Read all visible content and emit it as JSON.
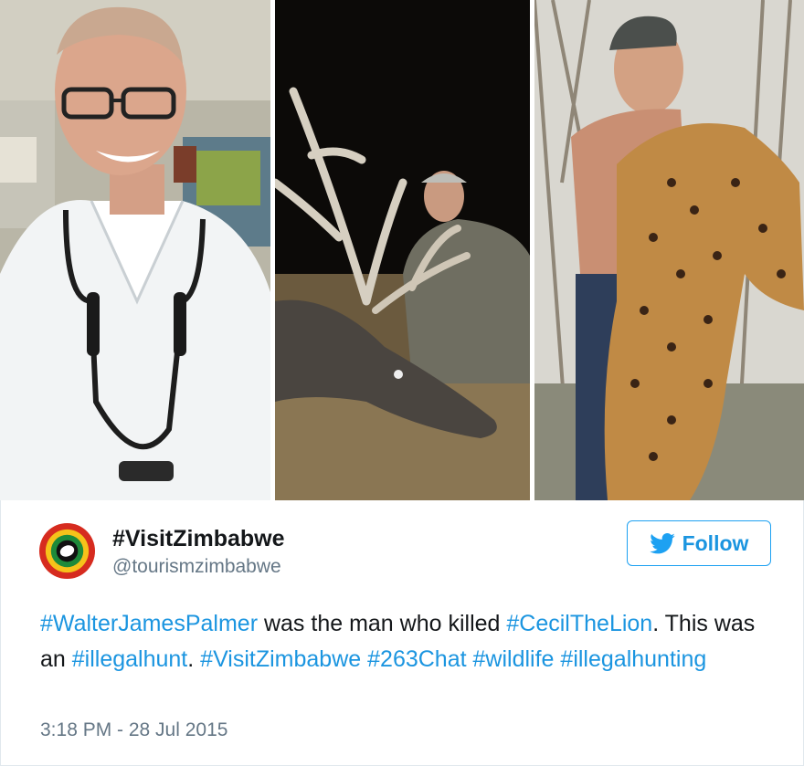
{
  "account": {
    "name": "#VisitZimbabwe",
    "handle": "@tourismzimbabwe"
  },
  "follow_label": "Follow",
  "tweet": {
    "parts": [
      {
        "text": "#WalterJamesPalmer",
        "hashtag": true
      },
      {
        "text": " was the man who killed ",
        "hashtag": false
      },
      {
        "text": "#CecilTheLion",
        "hashtag": true
      },
      {
        "text": ". This was an ",
        "hashtag": false
      },
      {
        "text": "#illegalhunt",
        "hashtag": true
      },
      {
        "text": ". ",
        "hashtag": false
      },
      {
        "text": "#VisitZimbabwe",
        "hashtag": true
      },
      {
        "text": " ",
        "hashtag": false
      },
      {
        "text": "#263Chat",
        "hashtag": true
      },
      {
        "text": " ",
        "hashtag": false
      },
      {
        "text": "#wildlife",
        "hashtag": true
      },
      {
        "text": " ",
        "hashtag": false
      },
      {
        "text": "#illegalhunting",
        "hashtag": true
      }
    ]
  },
  "timestamp": "3:18 PM - 28 Jul 2015",
  "colors": {
    "link": "#1b95e0",
    "text": "#14171a",
    "muted": "#657786"
  },
  "icons": {
    "follow": "twitter-bird-icon"
  }
}
